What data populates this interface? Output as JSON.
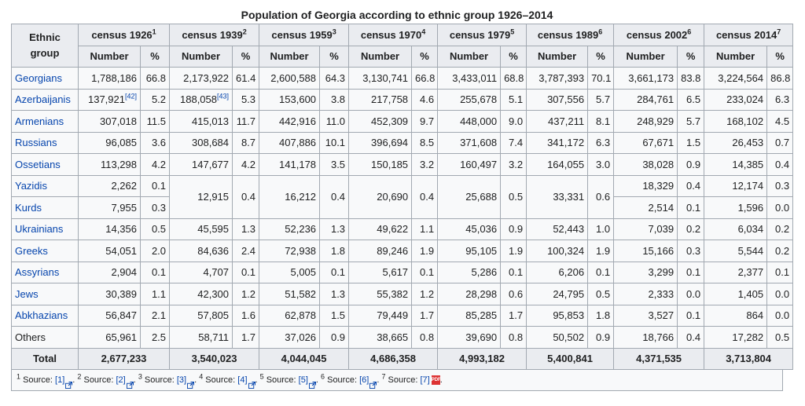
{
  "title": "Population of Georgia according to ethnic group 1926–2014",
  "header": {
    "ethnic_group": "Ethnic group",
    "number": "Number",
    "percent": "%",
    "censuses": [
      {
        "label": "census 1926",
        "sup": "1"
      },
      {
        "label": "census 1939",
        "sup": "2"
      },
      {
        "label": "census 1959",
        "sup": "3"
      },
      {
        "label": "census 1970",
        "sup": "4"
      },
      {
        "label": "census 1979",
        "sup": "5"
      },
      {
        "label": "census 1989",
        "sup": "6"
      },
      {
        "label": "census 2002",
        "sup": "6"
      },
      {
        "label": "census 2014",
        "sup": "7"
      }
    ]
  },
  "rows": [
    {
      "name": "Georgians",
      "c": [
        [
          "1,788,186",
          "66.8"
        ],
        [
          "2,173,922",
          "61.4"
        ],
        [
          "2,600,588",
          "64.3"
        ],
        [
          "3,130,741",
          "66.8"
        ],
        [
          "3,433,011",
          "68.8"
        ],
        [
          "3,787,393",
          "70.1"
        ],
        [
          "3,661,173",
          "83.8"
        ],
        [
          "3,224,564",
          "86.8"
        ]
      ]
    },
    {
      "name": "Azerbaijanis",
      "ref1926": "[42]",
      "ref1939": "[43]",
      "c": [
        [
          "137,921",
          "5.2"
        ],
        [
          "188,058",
          "5.3"
        ],
        [
          "153,600",
          "3.8"
        ],
        [
          "217,758",
          "4.6"
        ],
        [
          "255,678",
          "5.1"
        ],
        [
          "307,556",
          "5.7"
        ],
        [
          "284,761",
          "6.5"
        ],
        [
          "233,024",
          "6.3"
        ]
      ]
    },
    {
      "name": "Armenians",
      "c": [
        [
          "307,018",
          "11.5"
        ],
        [
          "415,013",
          "11.7"
        ],
        [
          "442,916",
          "11.0"
        ],
        [
          "452,309",
          "9.7"
        ],
        [
          "448,000",
          "9.0"
        ],
        [
          "437,211",
          "8.1"
        ],
        [
          "248,929",
          "5.7"
        ],
        [
          "168,102",
          "4.5"
        ]
      ]
    },
    {
      "name": "Russians",
      "c": [
        [
          "96,085",
          "3.6"
        ],
        [
          "308,684",
          "8.7"
        ],
        [
          "407,886",
          "10.1"
        ],
        [
          "396,694",
          "8.5"
        ],
        [
          "371,608",
          "7.4"
        ],
        [
          "341,172",
          "6.3"
        ],
        [
          "67,671",
          "1.5"
        ],
        [
          "26,453",
          "0.7"
        ]
      ]
    },
    {
      "name": "Ossetians",
      "c": [
        [
          "113,298",
          "4.2"
        ],
        [
          "147,677",
          "4.2"
        ],
        [
          "141,178",
          "3.5"
        ],
        [
          "150,185",
          "3.2"
        ],
        [
          "160,497",
          "3.2"
        ],
        [
          "164,055",
          "3.0"
        ],
        [
          "38,028",
          "0.9"
        ],
        [
          "14,385",
          "0.4"
        ]
      ]
    },
    {
      "name": "Yazidis",
      "c": [
        [
          "2,262",
          "0.1"
        ],
        [
          "12,915",
          "0.4"
        ],
        [
          "16,212",
          "0.4"
        ],
        [
          "20,690",
          "0.4"
        ],
        [
          "25,688",
          "0.5"
        ],
        [
          "33,331",
          "0.6"
        ],
        [
          "18,329",
          "0.4"
        ],
        [
          "12,174",
          "0.3"
        ]
      ]
    },
    {
      "name": "Kurds",
      "c": [
        [
          "7,955",
          "0.3"
        ],
        null,
        null,
        null,
        null,
        null,
        [
          "2,514",
          "0.1"
        ],
        [
          "1,596",
          "0.0"
        ]
      ]
    },
    {
      "name": "Ukrainians",
      "c": [
        [
          "14,356",
          "0.5"
        ],
        [
          "45,595",
          "1.3"
        ],
        [
          "52,236",
          "1.3"
        ],
        [
          "49,622",
          "1.1"
        ],
        [
          "45,036",
          "0.9"
        ],
        [
          "52,443",
          "1.0"
        ],
        [
          "7,039",
          "0.2"
        ],
        [
          "6,034",
          "0.2"
        ]
      ]
    },
    {
      "name": "Greeks",
      "c": [
        [
          "54,051",
          "2.0"
        ],
        [
          "84,636",
          "2.4"
        ],
        [
          "72,938",
          "1.8"
        ],
        [
          "89,246",
          "1.9"
        ],
        [
          "95,105",
          "1.9"
        ],
        [
          "100,324",
          "1.9"
        ],
        [
          "15,166",
          "0.3"
        ],
        [
          "5,544",
          "0.2"
        ]
      ]
    },
    {
      "name": "Assyrians",
      "c": [
        [
          "2,904",
          "0.1"
        ],
        [
          "4,707",
          "0.1"
        ],
        [
          "5,005",
          "0.1"
        ],
        [
          "5,617",
          "0.1"
        ],
        [
          "5,286",
          "0.1"
        ],
        [
          "6,206",
          "0.1"
        ],
        [
          "3,299",
          "0.1"
        ],
        [
          "2,377",
          "0.1"
        ]
      ]
    },
    {
      "name": "Jews",
      "c": [
        [
          "30,389",
          "1.1"
        ],
        [
          "42,300",
          "1.2"
        ],
        [
          "51,582",
          "1.3"
        ],
        [
          "55,382",
          "1.2"
        ],
        [
          "28,298",
          "0.6"
        ],
        [
          "24,795",
          "0.5"
        ],
        [
          "2,333",
          "0.0"
        ],
        [
          "1,405",
          "0.0"
        ]
      ]
    },
    {
      "name": "Abkhazians",
      "c": [
        [
          "56,847",
          "2.1"
        ],
        [
          "57,805",
          "1.6"
        ],
        [
          "62,878",
          "1.5"
        ],
        [
          "79,449",
          "1.7"
        ],
        [
          "85,285",
          "1.7"
        ],
        [
          "95,853",
          "1.8"
        ],
        [
          "3,527",
          "0.1"
        ],
        [
          "864",
          "0.0"
        ]
      ]
    },
    {
      "name": "Others",
      "plain": true,
      "c": [
        [
          "65,961",
          "2.5"
        ],
        [
          "58,711",
          "1.7"
        ],
        [
          "37,026",
          "0.9"
        ],
        [
          "38,665",
          "0.8"
        ],
        [
          "39,690",
          "0.8"
        ],
        [
          "50,502",
          "0.9"
        ],
        [
          "18,766",
          "0.4"
        ],
        [
          "17,282",
          "0.5"
        ]
      ]
    }
  ],
  "total": {
    "label": "Total",
    "values": [
      "2,677,233",
      "3,540,023",
      "4,044,045",
      "4,686,358",
      "4,993,182",
      "5,400,841",
      "4,371,535",
      "3,713,804"
    ]
  },
  "footnotes": [
    {
      "sup": "1",
      "text": " Source: ",
      "link": "[1]"
    },
    {
      "sup": "2",
      "text": " Source: ",
      "link": "[2]"
    },
    {
      "sup": "3",
      "text": " Source: ",
      "link": "[3]"
    },
    {
      "sup": "4",
      "text": " Source: ",
      "link": "[4]"
    },
    {
      "sup": "5",
      "text": " Source: ",
      "link": "[5]"
    },
    {
      "sup": "6",
      "text": " Source: ",
      "link": "[6]"
    },
    {
      "sup": "7",
      "text": " Source: ",
      "link": "[7]",
      "pdf": true
    }
  ],
  "colors": {
    "link": "#0645ad",
    "header_bg": "#eaecf0",
    "cell_bg": "#f8f9fa",
    "border": "#a2a9b1"
  },
  "icons": {
    "external": "external-link-icon",
    "pdf": "pdf-icon"
  }
}
